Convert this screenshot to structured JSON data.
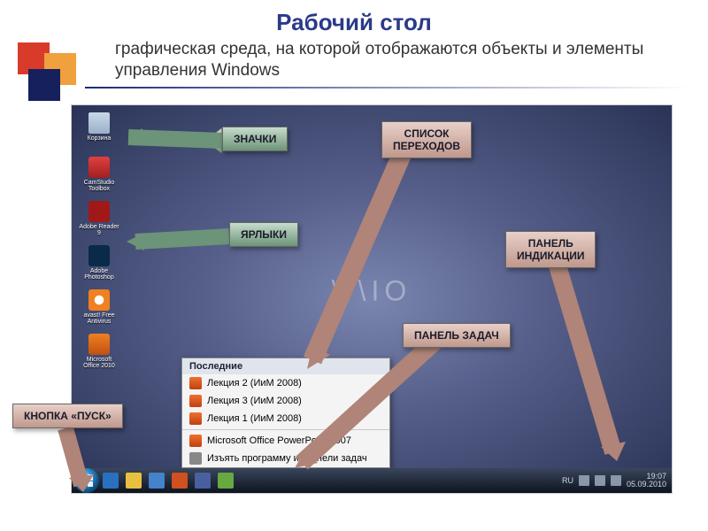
{
  "title": "Рабочий стол",
  "subtitle": "графическая среда, на которой отображаются объекты и элементы управления Windows",
  "watermark": "\\/\\IO",
  "icons": [
    {
      "name": "Корзина"
    },
    {
      "name": "CamStudio Toolbox"
    },
    {
      "name": "Adobe Reader 9"
    },
    {
      "name": "Adobe Photoshop"
    },
    {
      "name": "avast! Free Antivirus"
    },
    {
      "name": "Microsoft Office 2010"
    }
  ],
  "jumplist": {
    "header": "Последние",
    "items": [
      "Лекция 2 (ИиМ 2008)",
      "Лекция 3 (ИиМ 2008)",
      "Лекция 1 (ИиМ 2008)"
    ],
    "app": "Microsoft Office PowerPoint 2007",
    "unpin": "Изъять программу из панели задач"
  },
  "callouts": {
    "icons": "ЗНАЧКИ",
    "shortcuts": "ЯРЛЫКИ",
    "jumplist": "СПИСОК\nПЕРЕХОДОВ",
    "notification": "ПАНЕЛЬ\nИНДИКАЦИИ",
    "taskbar": "ПАНЕЛЬ ЗАДАЧ",
    "start": "КНОПКА «ПУСК»"
  },
  "tray": {
    "lang": "RU",
    "time": "19:07",
    "date": "05.09.2010"
  }
}
